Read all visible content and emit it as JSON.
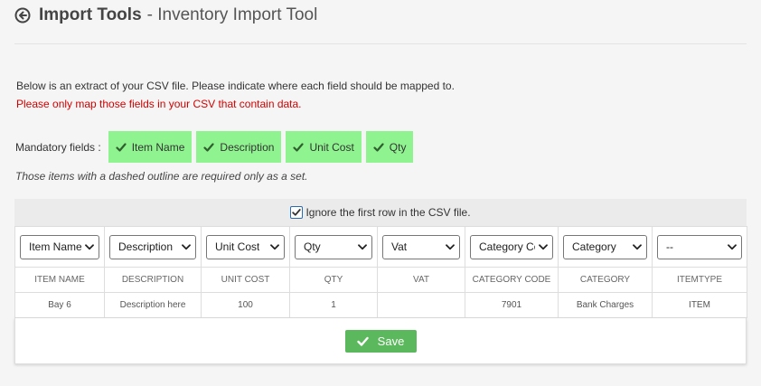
{
  "header": {
    "title_strong": "Import Tools",
    "title_rest": "- Inventory Import Tool",
    "back_icon": "arrow-circle-left-icon"
  },
  "intro_text": "Below is an extract of your CSV file. Please indicate where each field should be mapped to.",
  "warning_text": "Please only map those fields in your CSV that contain data.",
  "warning_color": "#d40000",
  "mandatory": {
    "label": "Mandatory fields :",
    "tags": [
      "Item Name",
      "Description",
      "Unit Cost",
      "Qty"
    ],
    "tag_color": "#8ff48f"
  },
  "set_note": "Those items with a dashed outline are required only as a set.",
  "ignore_first_row": {
    "label": "Ignore the first row in the CSV file.",
    "checked": true
  },
  "table": {
    "selects": [
      "Item Name",
      "Description",
      "Unit Cost",
      "Qty",
      "Vat",
      "Category Code",
      "Category",
      "--"
    ],
    "headers": [
      "ITEM NAME",
      "DESCRIPTION",
      "UNIT COST",
      "QTY",
      "VAT",
      "CATEGORY CODE",
      "CATEGORY",
      "ITEMTYPE"
    ],
    "row": [
      "Bay 6",
      "Description here",
      "100",
      "1",
      "",
      "7901",
      "Bank Charges",
      "ITEM"
    ]
  },
  "save_label": "Save",
  "save_color": "#5cb85c"
}
